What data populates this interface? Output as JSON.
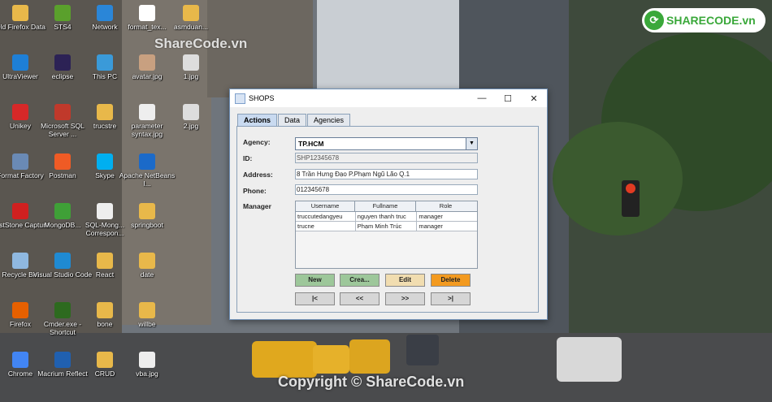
{
  "desktop": {
    "icons": [
      {
        "label": "Old Firefox Data",
        "icon": "folder-icon",
        "color": "#e8b84a"
      },
      {
        "label": "STS4",
        "icon": "sts-icon",
        "color": "#5aa02c"
      },
      {
        "label": "Network",
        "icon": "network-icon",
        "color": "#2a86d8"
      },
      {
        "label": "format_tex...",
        "icon": "file-icon",
        "color": "#ffffff"
      },
      {
        "label": "asmduan...",
        "icon": "folder-icon",
        "color": "#e8b84a"
      },
      {
        "label": "UltraViewer",
        "icon": "ultraviewer-icon",
        "color": "#1e7fd6"
      },
      {
        "label": "eclipse",
        "icon": "eclipse-icon",
        "color": "#2c2255"
      },
      {
        "label": "This PC",
        "icon": "computer-icon",
        "color": "#3a9ad9"
      },
      {
        "label": "avatar.jpg",
        "icon": "image-icon",
        "color": "#c8a080"
      },
      {
        "label": "1.jpg",
        "icon": "image-icon",
        "color": "#dddddd"
      },
      {
        "label": "Unikey",
        "icon": "unikey-icon",
        "color": "#d62828"
      },
      {
        "label": "Microsoft SQL Server ...",
        "icon": "sqlserver-icon",
        "color": "#c0392b"
      },
      {
        "label": "trucstre",
        "icon": "folder-icon",
        "color": "#e8b84a"
      },
      {
        "label": "parameter syntax.jpg",
        "icon": "image-icon",
        "color": "#eeeeee"
      },
      {
        "label": "2.jpg",
        "icon": "image-icon",
        "color": "#dddddd"
      },
      {
        "label": "Format Factory",
        "icon": "formatfactory-icon",
        "color": "#6a8ab5"
      },
      {
        "label": "Postman",
        "icon": "postman-icon",
        "color": "#ef5b25"
      },
      {
        "label": "Skype",
        "icon": "skype-icon",
        "color": "#00aff0"
      },
      {
        "label": "Apache NetBeans I...",
        "icon": "netbeans-icon",
        "color": "#1b6ac9"
      },
      {
        "label": "FastStone Capture",
        "icon": "faststone-icon",
        "color": "#d02020"
      },
      {
        "label": "MongoDB...",
        "icon": "mongodb-icon",
        "color": "#3fa037"
      },
      {
        "label": "SQL-Mong... Correspon...",
        "icon": "file-icon",
        "color": "#eeeeee"
      },
      {
        "label": "springboot",
        "icon": "folder-icon",
        "color": "#e8b84a"
      },
      {
        "label": "Recycle Bin",
        "icon": "recycle-bin-icon",
        "color": "#8fb8e0"
      },
      {
        "label": "Visual Studio Code",
        "icon": "vscode-icon",
        "color": "#1f8ad2"
      },
      {
        "label": "React",
        "icon": "folder-icon",
        "color": "#e8b84a"
      },
      {
        "label": "date",
        "icon": "folder-icon",
        "color": "#e8b84a"
      },
      {
        "label": "Firefox",
        "icon": "firefox-icon",
        "color": "#e66000"
      },
      {
        "label": "Cmder.exe - Shortcut",
        "icon": "cmder-icon",
        "color": "#2d6a1f"
      },
      {
        "label": "bone",
        "icon": "folder-icon",
        "color": "#e8b84a"
      },
      {
        "label": "willbe",
        "icon": "folder-icon",
        "color": "#e8b84a"
      },
      {
        "label": "Chrome",
        "icon": "chrome-icon",
        "color": "#4285f4"
      },
      {
        "label": "Macrium Reflect",
        "icon": "macrium-icon",
        "color": "#2060b0"
      },
      {
        "label": "CRUD",
        "icon": "folder-icon",
        "color": "#e8b84a"
      },
      {
        "label": "vba.jpg",
        "icon": "image-icon",
        "color": "#eeeeee"
      }
    ],
    "watermark_top": "ShareCode.vn",
    "watermark_bottom": "Copyright © ShareCode.vn",
    "logo_text": "SHARECODE.vn",
    "logo_color": "#3aa83a"
  },
  "window": {
    "title": "SHOPS",
    "tabs": [
      {
        "label": "Actions",
        "active": true
      },
      {
        "label": "Data",
        "active": false
      },
      {
        "label": "Agencies",
        "active": false
      }
    ],
    "form": {
      "agency_label": "Agency:",
      "agency_value": "TP.HCM",
      "id_label": "ID:",
      "id_value": "SHP12345678",
      "address_label": "Address:",
      "address_value": "8 Trần Hưng Đạo P.Phạm Ngũ Lão Q.1",
      "phone_label": "Phone:",
      "phone_value": "012345678",
      "manager_label": "Manager"
    },
    "managers": {
      "columns": [
        "Username",
        "Fullname",
        "Role"
      ],
      "rows": [
        [
          "truccutedangyeu",
          "nguyen thanh truc",
          "manager"
        ],
        [
          "trucne",
          "Phạm Minh Trúc",
          "manager"
        ]
      ]
    },
    "buttons": {
      "new": "New",
      "create": "Crea...",
      "edit": "Edit",
      "delete": "Delete",
      "first": "|<",
      "prev": "<<",
      "next": ">>",
      "last": ">|"
    },
    "colors": {
      "new": "#9dc79a",
      "create": "#9dc79a",
      "edit": "#f1ddb0",
      "delete": "#f39a1f",
      "nav": "#d6d6d6"
    }
  }
}
